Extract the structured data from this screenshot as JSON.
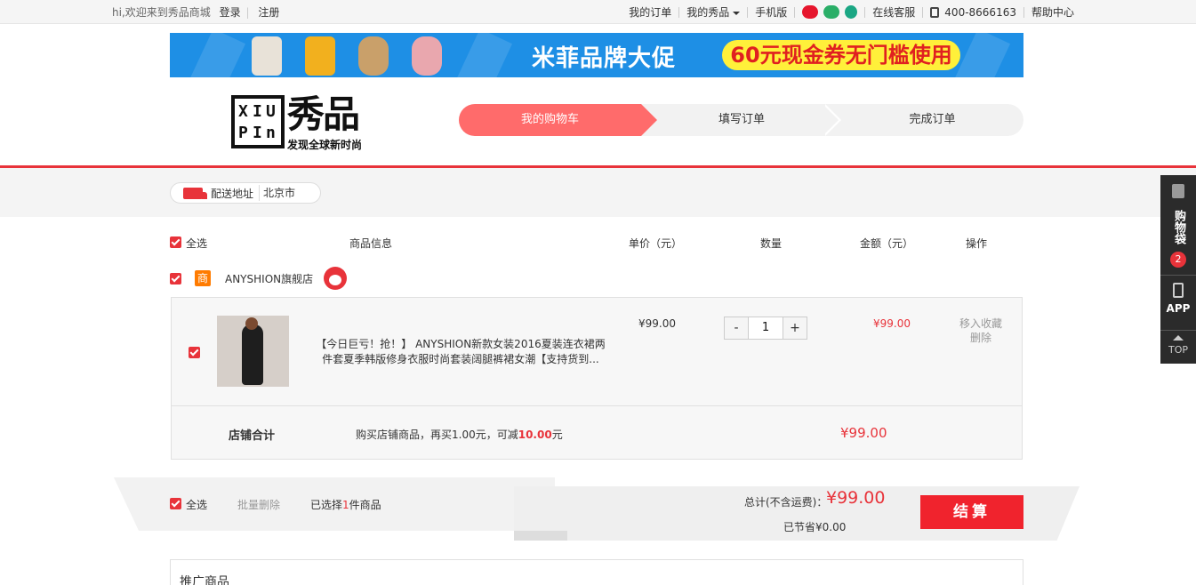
{
  "topbar": {
    "welcome": "hi,欢迎来到秀品商城",
    "login": "登录",
    "register": "注册",
    "links": [
      "我的订单",
      "我的秀品",
      "手机版"
    ],
    "service": "在线客服",
    "phone": "400-8666163",
    "help": "帮助中心"
  },
  "banner": {
    "headline": "米菲品牌大促",
    "coupon": "60元现金券无门槛使用"
  },
  "logo": {
    "mark_letters": [
      "X",
      "I",
      "U",
      "P",
      "I",
      "n"
    ],
    "name": "秀品",
    "slogan": "发现全球新时尚"
  },
  "steps": [
    "我的购物车",
    "填写订单",
    "完成订单"
  ],
  "address": {
    "label": "配送地址",
    "city": "北京市"
  },
  "table_header": {
    "select_all": "全选",
    "product_info": "商品信息",
    "unit_price": "单价（元）",
    "quantity": "数量",
    "amount": "金额（元）",
    "actions": "操作"
  },
  "store": {
    "shop_badge": "商",
    "name": "ANYSHION旗舰店"
  },
  "item": {
    "name": "【今日巨亏！抢！】 ANYSHION新款女装2016夏装连衣裙两件套夏季韩版修身衣服时尚套装阔腿裤裙女潮【支持货到...",
    "unit_price": "¥99.00",
    "qty_minus": "-",
    "qty": "1",
    "qty_plus": "+",
    "line_total": "¥99.00",
    "move_to_fav": "移入收藏",
    "delete": "删除"
  },
  "store_total": {
    "label": "店铺合计",
    "promo_prefix": "购买店铺商品，再买1.00元，可减",
    "promo_amount": "10.00",
    "promo_suffix": "元",
    "amount": "¥99.00"
  },
  "footer_bar": {
    "select_all": "全选",
    "batch_delete": "批量删除",
    "selected_prefix": "已选择",
    "selected_count": "1",
    "selected_suffix": "件商品",
    "total_label": "总计(不含运费)：",
    "total": "¥99.00",
    "saved": "已节省¥0.00",
    "checkout": "结算"
  },
  "promo_section": {
    "title": "推广商品"
  },
  "sidebar": {
    "bag_label": "购物袋",
    "bag_count": "2",
    "app": "APP",
    "top": "TOP"
  },
  "colors": {
    "accent": "#e8333a",
    "step_active": "#ff6b6b",
    "checkout": "#f0232d",
    "banner_bg": "#1e8fe5",
    "coupon_bg": "#fff03a"
  }
}
